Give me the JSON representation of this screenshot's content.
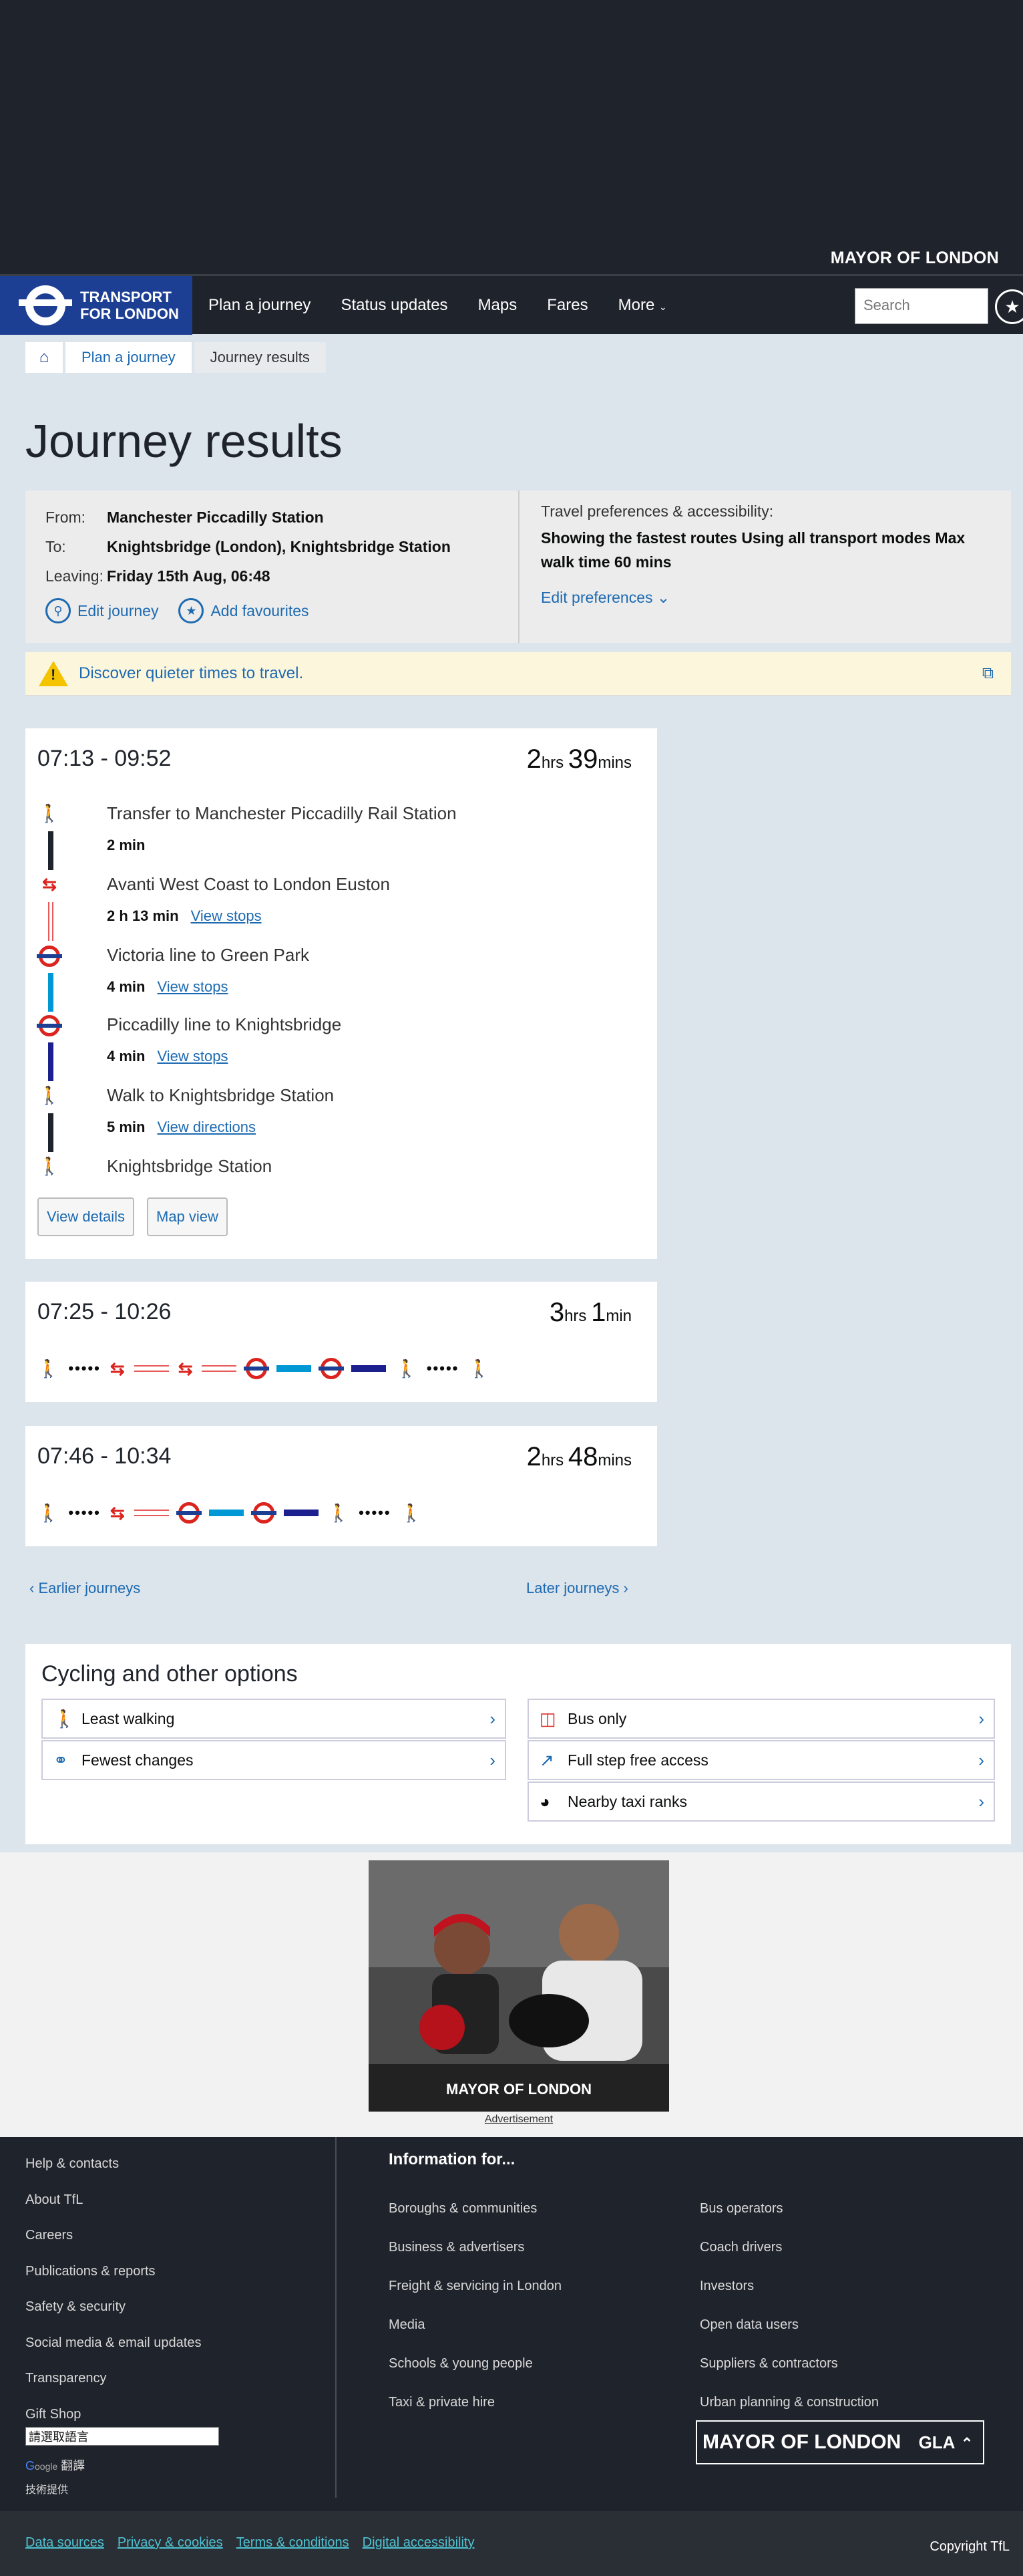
{
  "header": {
    "mayor": "MAYOR OF LONDON",
    "brand_line1": "TRANSPORT",
    "brand_line2": "FOR LONDON",
    "nav": [
      "Plan a journey",
      "Status updates",
      "Maps",
      "Fares",
      "More"
    ],
    "search_placeholder": "Search"
  },
  "breadcrumb": {
    "items": [
      "Plan a journey",
      "Journey results"
    ]
  },
  "page_title": "Journey results",
  "summary": {
    "from_label": "From:",
    "from": "Manchester Piccadilly Station",
    "to_label": "To:",
    "to": "Knightsbridge (London), Knightsbridge Station",
    "leaving_label": "Leaving:",
    "leaving": "Friday 15th Aug, 06:48",
    "edit_journey": "Edit journey",
    "add_favourites": "Add favourites",
    "prefs_label": "Travel preferences & accessibility:",
    "prefs_text": "Showing the fastest routes Using all transport modes Max walk time 60 mins",
    "edit_prefs": "Edit preferences"
  },
  "banner": {
    "text": "Discover quieter times to travel."
  },
  "journeys": [
    {
      "time": "07:13 - 09:52",
      "hrs": "2",
      "hrs_unit": "hrs",
      "mins": "39",
      "mins_unit": "mins",
      "legs": [
        {
          "title": "Transfer to Manchester Piccadilly Rail Station",
          "sub": "2 min",
          "link": ""
        },
        {
          "title": "Avanti West Coast to London Euston",
          "sub": "2 h 13 min",
          "link": "View stops"
        },
        {
          "title": "Victoria line to Green Park",
          "sub": "4 min",
          "link": "View stops"
        },
        {
          "title": "Piccadilly line to Knightsbridge",
          "sub": "4 min",
          "link": "View stops"
        },
        {
          "title": "Walk to Knightsbridge Station",
          "sub": "5 min",
          "link": "View directions"
        },
        {
          "title": "Knightsbridge Station",
          "sub": "",
          "link": ""
        }
      ],
      "view_details": "View details",
      "map_view": "Map view"
    },
    {
      "time": "07:25 - 10:26",
      "hrs": "3",
      "hrs_unit": "hrs",
      "mins": "1",
      "mins_unit": "min"
    },
    {
      "time": "07:46 - 10:34",
      "hrs": "2",
      "hrs_unit": "hrs",
      "mins": "48",
      "mins_unit": "mins"
    }
  ],
  "pager": {
    "earlier": "Earlier journeys",
    "later": "Later journeys"
  },
  "cycling": {
    "title": "Cycling and other options",
    "options": [
      "Least walking",
      "Fewest changes",
      "Bus only",
      "Full step free access",
      "Nearby taxi ranks"
    ]
  },
  "ad": {
    "brand": "MAYOR OF LONDON",
    "label": "Advertisement"
  },
  "footer": {
    "left": [
      "Help & contacts",
      "About TfL",
      "Careers",
      "Publications & reports",
      "Safety & security",
      "Social media & email updates",
      "Transparency",
      "Gift Shop"
    ],
    "info_title": "Information for...",
    "col1": [
      "Boroughs & communities",
      "Business & advertisers",
      "Freight & servicing in London",
      "Media",
      "Schools & young people",
      "Taxi & private hire"
    ],
    "col2": [
      "Bus operators",
      "Coach drivers",
      "Investors",
      "Open data users",
      "Suppliers & contractors",
      "Urban planning & construction"
    ],
    "lang_select": "請選取語言",
    "translate": "翻譯",
    "powered": "技術提供",
    "mayor_logo": "MAYOR OF LONDON",
    "gla": "GLA",
    "bottom_links": [
      "Data sources",
      "Privacy & cookies",
      "Terms & conditions",
      "Digital accessibility"
    ],
    "copyright": "Copyright TfL"
  }
}
